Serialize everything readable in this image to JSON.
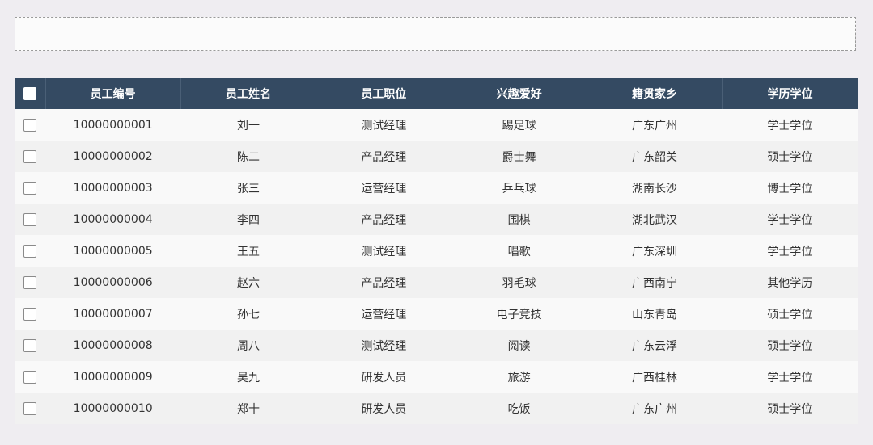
{
  "table": {
    "columns": [
      "员工编号",
      "员工姓名",
      "员工职位",
      "兴趣爱好",
      "籍贯家乡",
      "学历学位"
    ],
    "rows": [
      [
        "10000000001",
        "刘一",
        "测试经理",
        "踢足球",
        "广东广州",
        "学士学位"
      ],
      [
        "10000000002",
        "陈二",
        "产品经理",
        "爵士舞",
        "广东韶关",
        "硕士学位"
      ],
      [
        "10000000003",
        "张三",
        "运营经理",
        "乒乓球",
        "湖南长沙",
        "博士学位"
      ],
      [
        "10000000004",
        "李四",
        "产品经理",
        "围棋",
        "湖北武汉",
        "学士学位"
      ],
      [
        "10000000005",
        "王五",
        "测试经理",
        "唱歌",
        "广东深圳",
        "学士学位"
      ],
      [
        "10000000006",
        "赵六",
        "产品经理",
        "羽毛球",
        "广西南宁",
        "其他学历"
      ],
      [
        "10000000007",
        "孙七",
        "运营经理",
        "电子竞技",
        "山东青岛",
        "硕士学位"
      ],
      [
        "10000000008",
        "周八",
        "测试经理",
        "阅读",
        "广东云浮",
        "硕士学位"
      ],
      [
        "10000000009",
        "吴九",
        "研发人员",
        "旅游",
        "广西桂林",
        "学士学位"
      ],
      [
        "10000000010",
        "郑十",
        "研发人员",
        "吃饭",
        "广东广州",
        "硕士学位"
      ]
    ]
  },
  "colors": {
    "header_bg": "#344a62",
    "row_odd": "#f9f9f9",
    "row_even": "#f1f1f1"
  }
}
